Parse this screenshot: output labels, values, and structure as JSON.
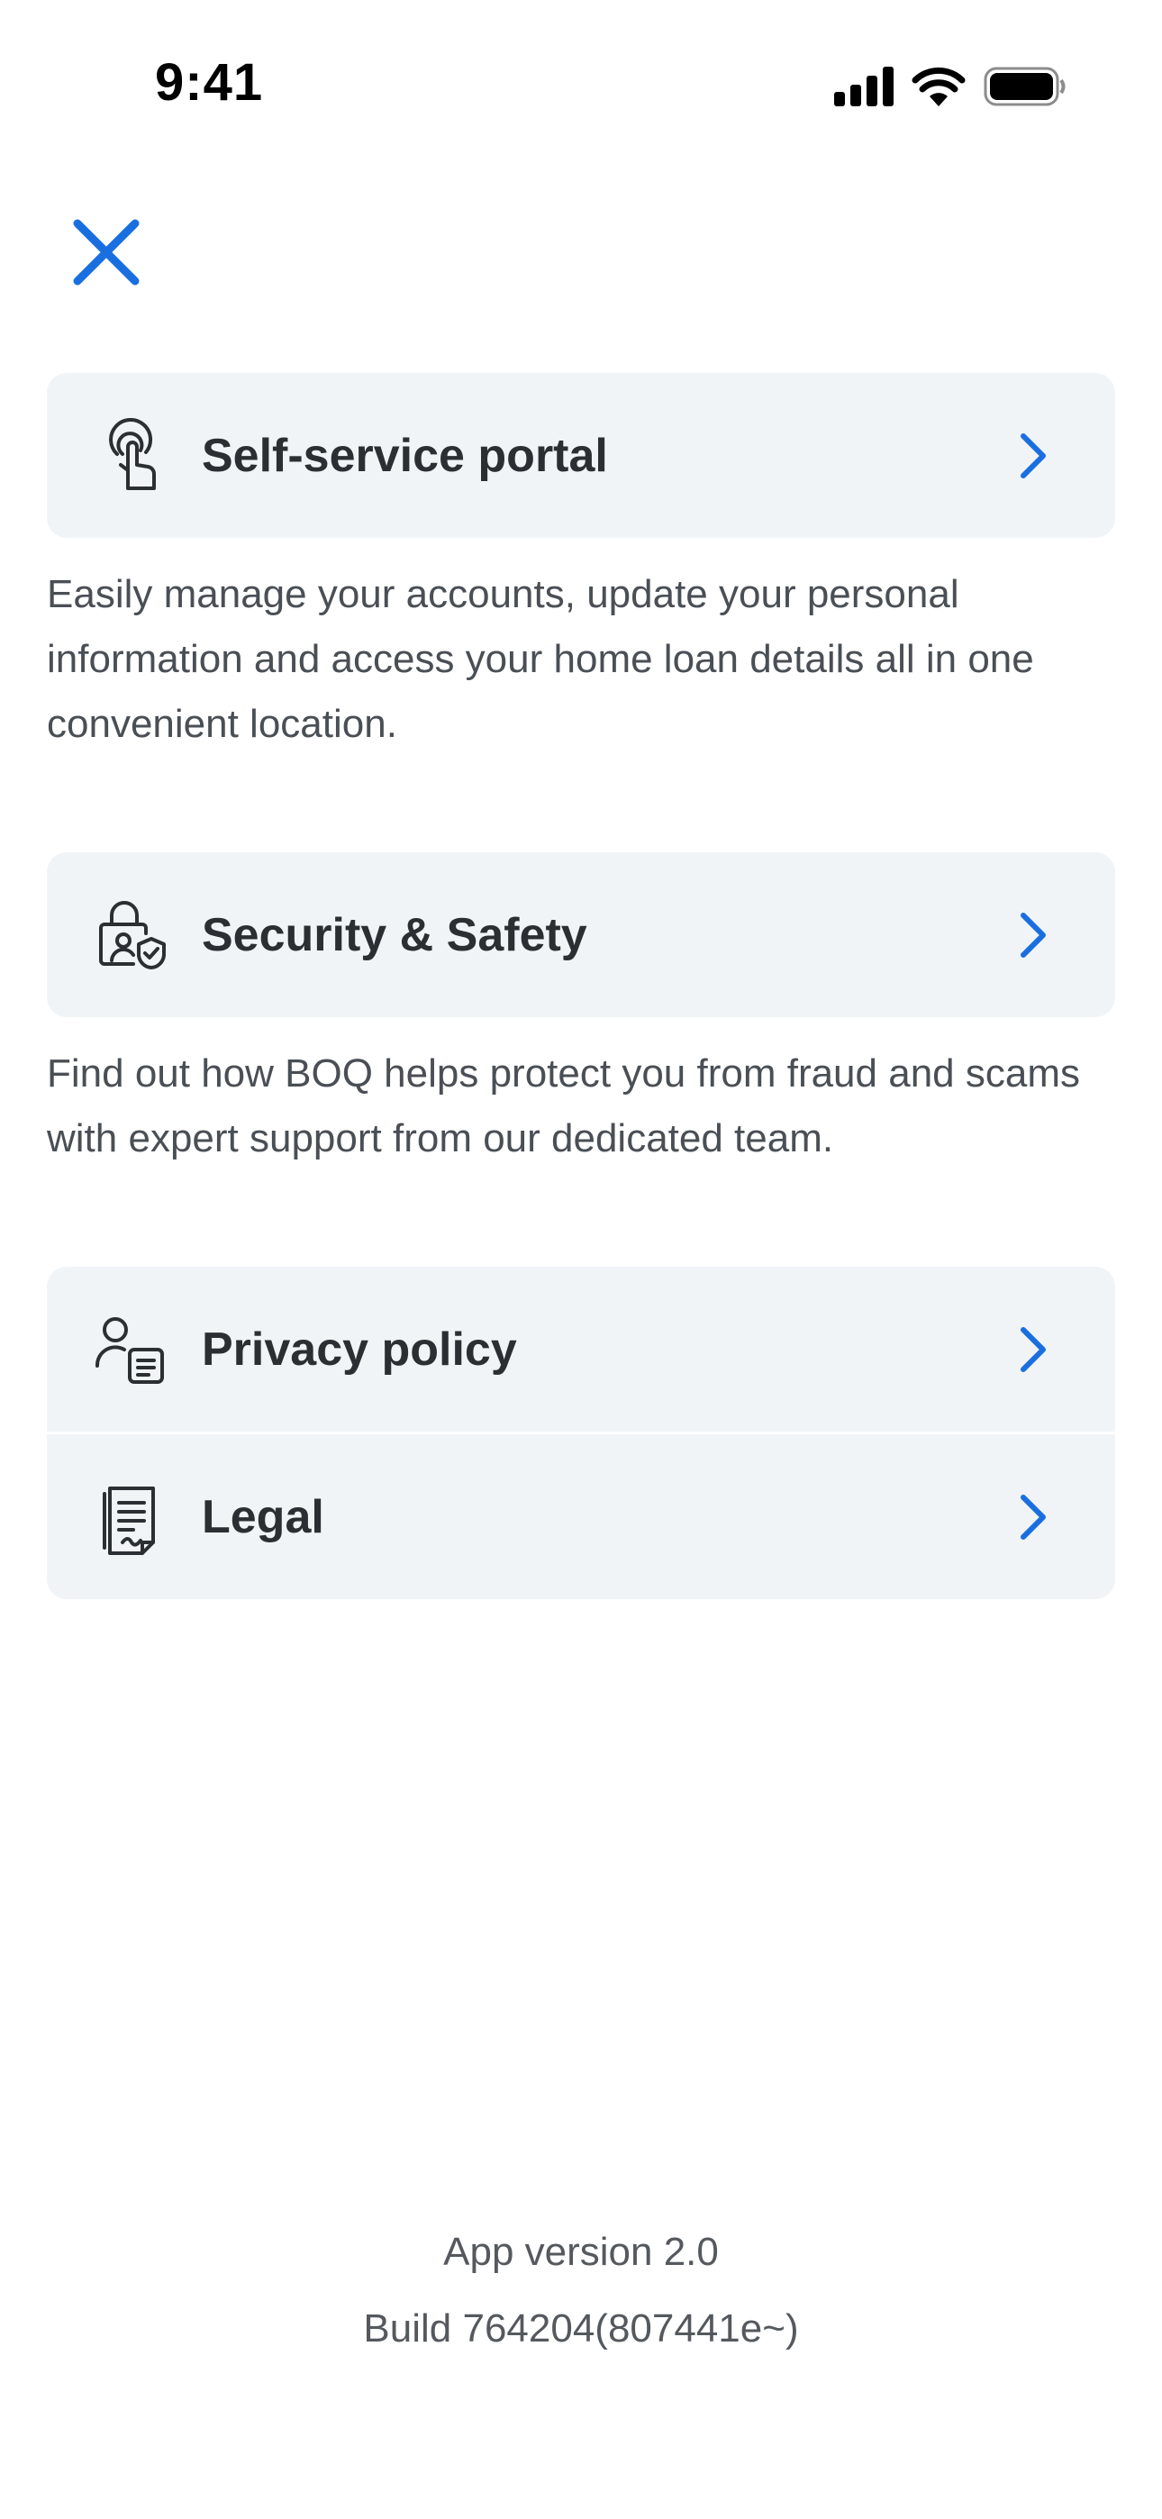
{
  "status_bar": {
    "time": "9:41",
    "icons": [
      "cellular-signal-icon",
      "wifi-icon",
      "battery-icon"
    ]
  },
  "header": {
    "close_icon": "close-icon",
    "accent_color": "#1a6fe0"
  },
  "sections": {
    "self_service": {
      "label": "Self-service portal",
      "icon": "touch-hand-icon",
      "description": "Easily manage your accounts, update your personal information and access your home loan details all in one convenient location."
    },
    "security": {
      "label": "Security & Safety",
      "icon": "lock-shield-icon",
      "description": "Find out how BOQ helps protect you from fraud and scams with expert support from our dedicated team."
    },
    "privacy": {
      "label": "Privacy policy",
      "icon": "person-document-icon"
    },
    "legal": {
      "label": "Legal",
      "icon": "legal-document-icon"
    }
  },
  "footer": {
    "version": "App version 2.0",
    "build": "Build 764204(807441e~)"
  }
}
